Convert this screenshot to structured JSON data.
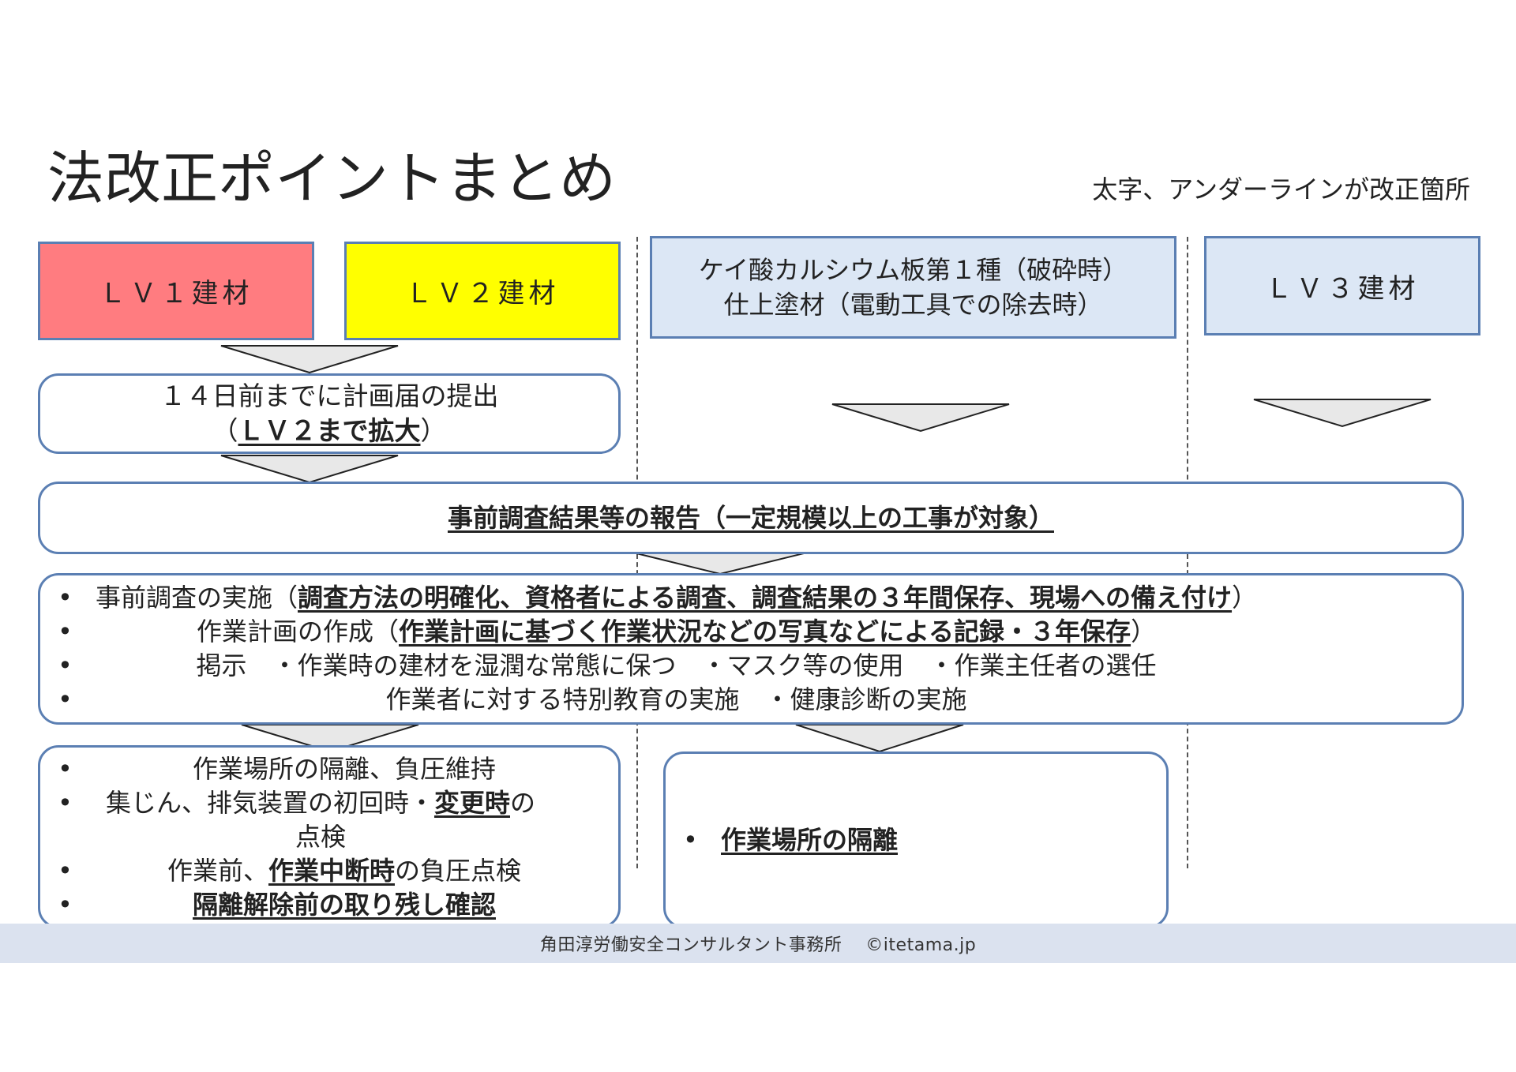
{
  "title": "法改正ポイントまとめ",
  "note": "太字、アンダーラインが改正箇所",
  "colors": {
    "lv1": "#ff7c80",
    "lv2": "#ffff00",
    "light": "#dce7f5",
    "border": "#5b7fb3",
    "footer_bg": "#dbe2ef"
  },
  "headers": {
    "lv1": "ＬＶ１建材",
    "lv2": "ＬＶ２建材",
    "calcium_line1": "ケイ酸カルシウム板第１種（破砕時）",
    "calcium_line2": "仕上塗材（電動工具での除去時）",
    "lv3": "ＬＶ３建材"
  },
  "plan_notice": {
    "line1": "１４日前までに計画届の提出",
    "line2_open": "（",
    "line2_bold": "ＬＶ２まで拡大",
    "line2_close": "）"
  },
  "report": "事前調査結果等の報告（一定規模以上の工事が対象）",
  "requirements": {
    "item1_prefix": "事前調査の実施（",
    "item1_bold": "調査方法の明確化、資格者による調査、調査結果の３年間保存、現場への備え付け",
    "item1_suffix": "）",
    "item2_prefix": "作業計画の作成（",
    "item2_bold": "作業計画に基づく作業状況などの写真などによる記録・３年保存",
    "item2_suffix": "）",
    "item3": "掲示　・作業時の建材を湿潤な常態に保つ　・マスク等の使用　・作業主任者の選任",
    "item4": "作業者に対する特別教育の実施　・健康診断の実施"
  },
  "lv12_measures": {
    "item1": "作業場所の隔離、負圧維持",
    "item2_prefix": "集じん、排気装置の初回時・",
    "item2_bold": "変更時",
    "item2_suffix": "の点検",
    "item3_prefix": "作業前、",
    "item3_bold": "作業中断時",
    "item3_suffix": "の負圧点検",
    "item4_bold": "隔離解除前の取り残し確認"
  },
  "calcium_measure": "作業場所の隔離",
  "footer": "角田淳労働安全コンサルタント事務所　 ©itetama.jp"
}
